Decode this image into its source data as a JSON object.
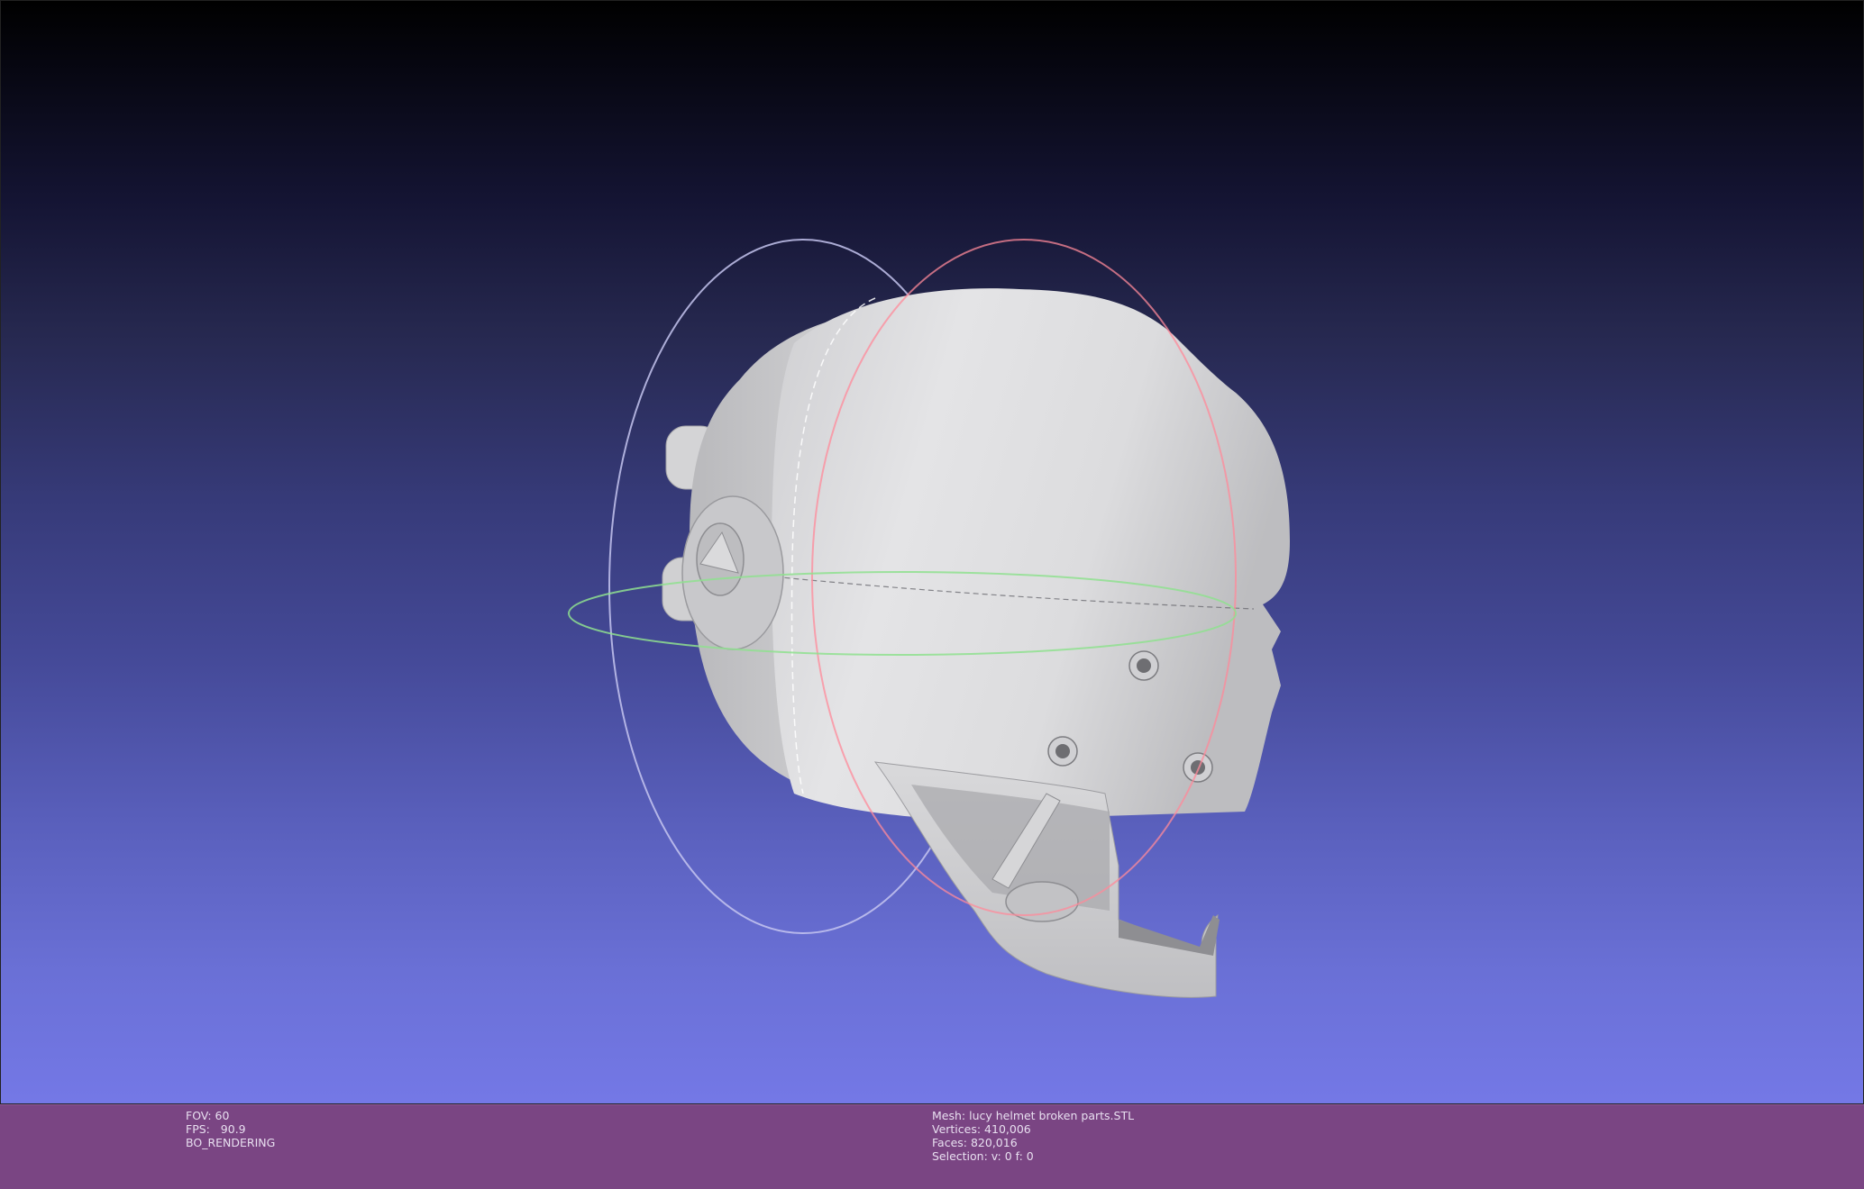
{
  "app": "MeshLab viewer",
  "viewport": {
    "background_top": "#000000",
    "background_bottom": "#7478e6",
    "model": "lucy helmet (broken parts)",
    "trackball": {
      "horizontal_ring_color": "#8fe08f",
      "vertical_ring_front_color": "#ff8a9a",
      "vertical_ring_side_color": "#c8c8ff"
    }
  },
  "status_left": {
    "fov": "FOV: 60",
    "fps": "FPS:   90.9",
    "mode": "BO_RENDERING"
  },
  "status_right": {
    "mesh": "Mesh: lucy helmet broken parts.STL",
    "vertices": "Vertices: 410,006",
    "faces": "Faces: 820,016",
    "selection": "Selection: v: 0 f: 0"
  }
}
